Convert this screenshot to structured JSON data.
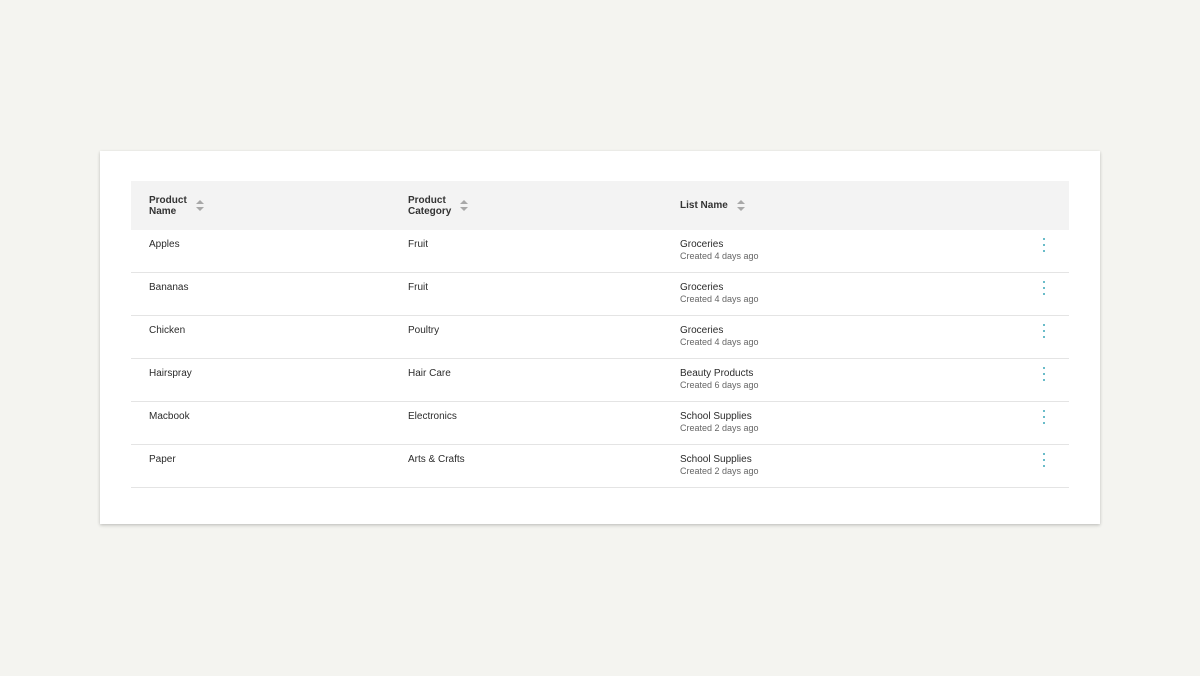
{
  "table": {
    "headers": [
      {
        "line1": "Product",
        "line2": "Name"
      },
      {
        "line1": "Product",
        "line2": "Category"
      },
      {
        "line1": "List Name",
        "line2": ""
      }
    ],
    "rows": [
      {
        "name": "Apples",
        "category": "Fruit",
        "list": "Groceries",
        "created": "Created 4 days ago"
      },
      {
        "name": "Bananas",
        "category": "Fruit",
        "list": "Groceries",
        "created": "Created 4 days ago"
      },
      {
        "name": "Chicken",
        "category": "Poultry",
        "list": "Groceries",
        "created": "Created 4 days ago"
      },
      {
        "name": "Hairspray",
        "category": "Hair Care",
        "list": "Beauty Products",
        "created": "Created 6 days ago"
      },
      {
        "name": "Macbook",
        "category": "Electronics",
        "list": "School Supplies",
        "created": "Created 2 days ago"
      },
      {
        "name": "Paper",
        "category": "Arts & Crafts",
        "list": "School Supplies",
        "created": "Created 2 days ago"
      }
    ],
    "icons": {
      "sort": "sort-icon",
      "row_menu": "more-vertical-icon"
    },
    "colors": {
      "accent": "#3aa7b8",
      "header_bg": "#f3f3f3",
      "page_bg": "#f4f4f0"
    }
  }
}
